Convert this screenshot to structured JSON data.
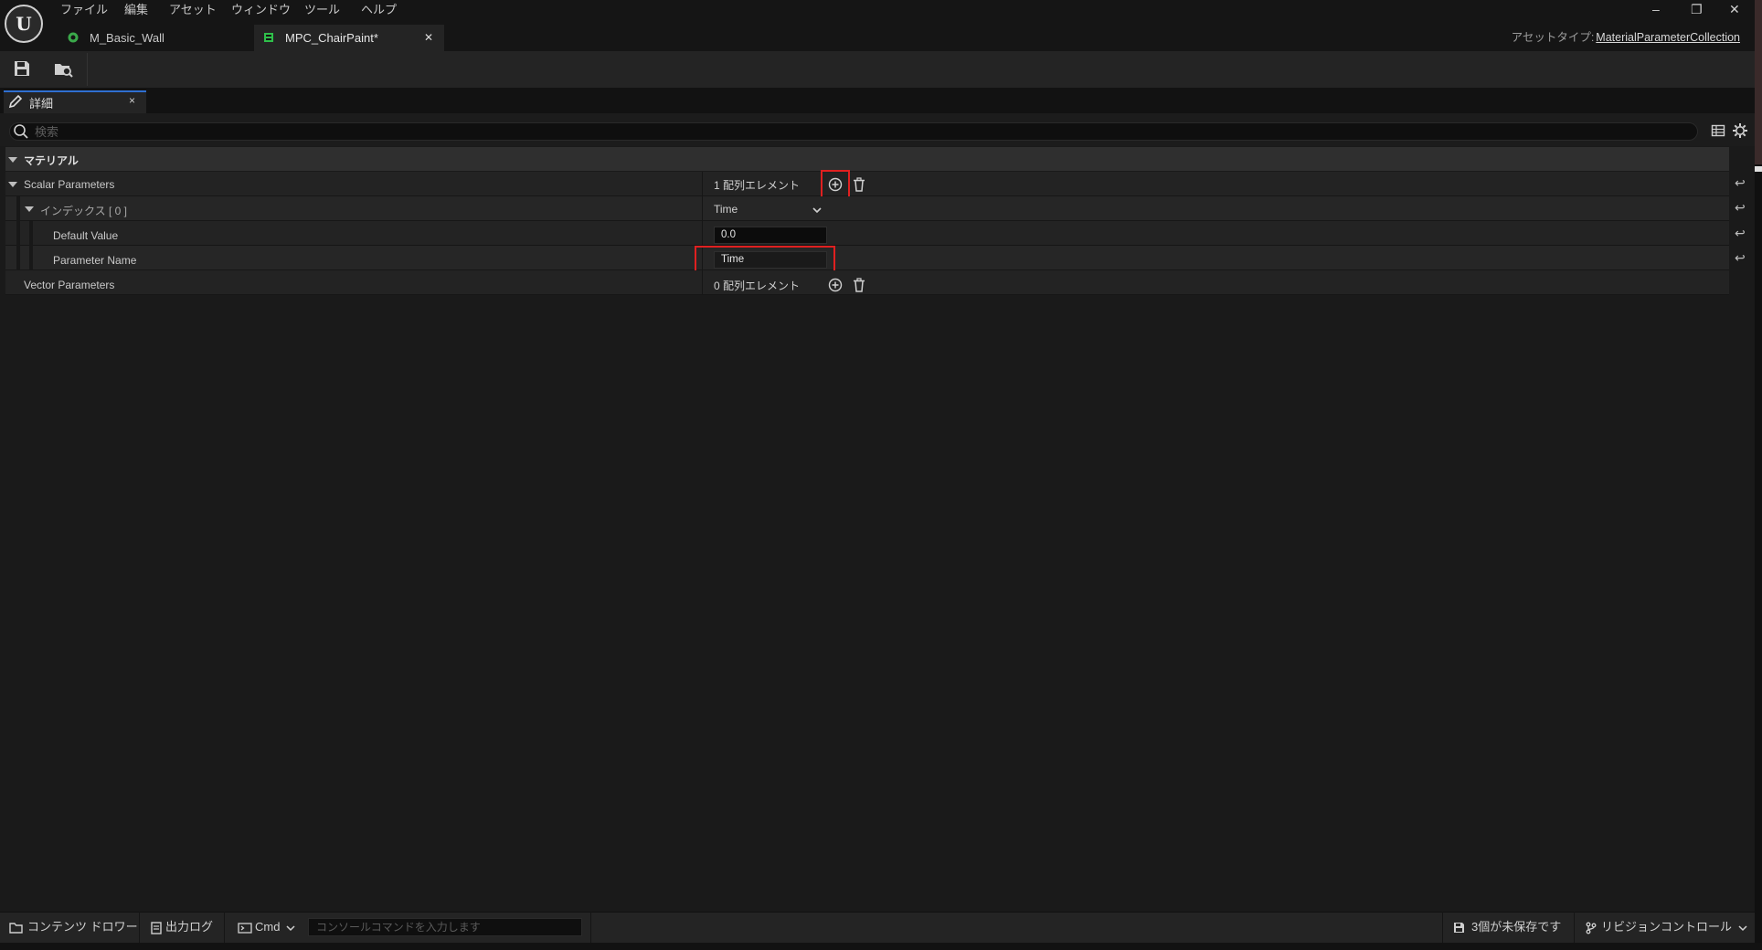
{
  "titlebar": {
    "logo": "U",
    "menu": [
      "ファイル",
      "編集",
      "アセット",
      "ウィンドウ",
      "ツール",
      "ヘルプ"
    ],
    "tabs": [
      {
        "label": "M_Basic_Wall",
        "icon": "material-icon",
        "icon_color": "#3aa84a"
      },
      {
        "label": "MPC_ChairPaint*",
        "icon": "material-parameter-collection-icon",
        "icon_color": "#2fbf4a",
        "active": true
      }
    ],
    "asset_type_label": "アセットタイプ:",
    "asset_type_value": "MaterialParameterCollection",
    "window_controls": {
      "minimize": "–",
      "restore": "❐",
      "close": "✕"
    }
  },
  "toolbar": {
    "buttons": [
      "save-icon",
      "browse-to-asset-icon"
    ]
  },
  "panel": {
    "tab_label": "詳細",
    "tab_close": "×",
    "search_placeholder": "検索"
  },
  "category": {
    "label": "マテリアル"
  },
  "properties": {
    "scalar": {
      "label": "Scalar Parameters",
      "value": "1 配列エレメント"
    },
    "index0": {
      "label": "インデックス [ 0 ]",
      "value": "Time"
    },
    "default_value": {
      "label": "Default Value",
      "value": "0.0"
    },
    "param_name": {
      "label": "Parameter Name",
      "value": "Time"
    },
    "vector": {
      "label": "Vector Parameters",
      "value": "0 配列エレメント"
    }
  },
  "bottombar": {
    "content_drawer": "コンテンツ ドロワー",
    "output_log": "出力ログ",
    "cmd": "Cmd",
    "cmd_placeholder": "コンソールコマンドを入力します",
    "unsaved": "3個が未保存です",
    "revision_control": "リビジョンコントロール"
  },
  "colors": {
    "highlight_box": "#e02020",
    "accent": "#2f6fd0"
  }
}
